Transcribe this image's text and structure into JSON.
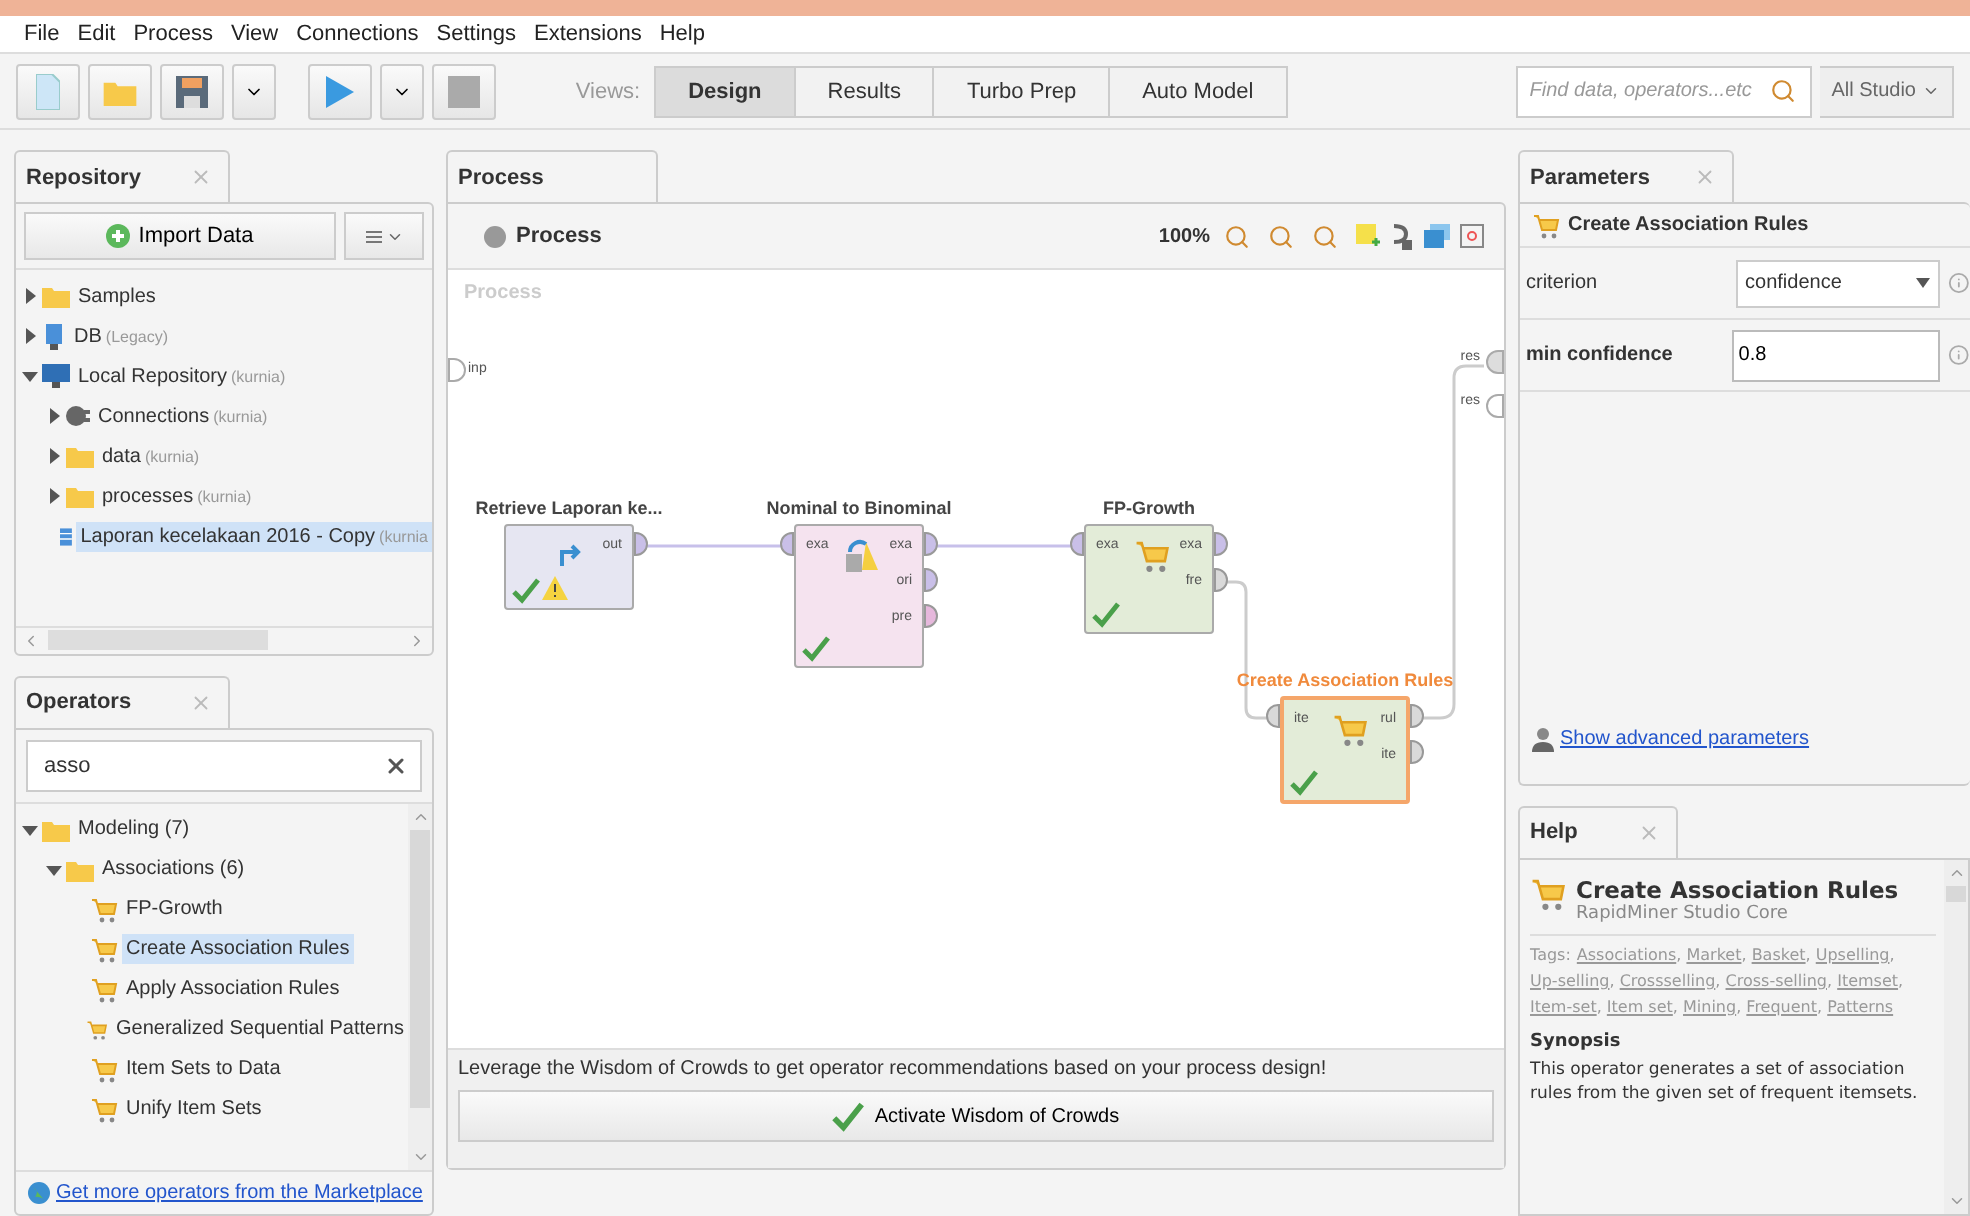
{
  "menu": [
    "File",
    "Edit",
    "Process",
    "View",
    "Connections",
    "Settings",
    "Extensions",
    "Help"
  ],
  "toolbar": {
    "views_label": "Views:",
    "views": [
      {
        "label": "Design",
        "selected": true
      },
      {
        "label": "Results",
        "selected": false
      },
      {
        "label": "Turbo Prep",
        "selected": false
      },
      {
        "label": "Auto Model",
        "selected": false
      }
    ],
    "search": {
      "placeholder": "Find data, operators...etc"
    },
    "scope": "All Studio"
  },
  "repository": {
    "title": "Repository",
    "import_button": "Import Data",
    "items": [
      {
        "name": "Samples",
        "kind": "folder",
        "expanded": false,
        "selected": false
      },
      {
        "name": "DB",
        "note": "(Legacy)",
        "kind": "database",
        "expanded": false,
        "selected": false
      },
      {
        "name": "Local Repository",
        "note": "(kurnia)",
        "kind": "repository",
        "expanded": true,
        "selected": false,
        "children": [
          {
            "name": "Connections",
            "note": "(kurnia)",
            "kind": "connection",
            "expanded": false,
            "selected": false
          },
          {
            "name": "data",
            "note": "(kurnia)",
            "kind": "folder",
            "expanded": false,
            "selected": false
          },
          {
            "name": "processes",
            "note": "(kurnia)",
            "kind": "folder",
            "expanded": false,
            "selected": false
          },
          {
            "name": "Laporan kecelakaan 2016 - Copy",
            "note": "(kurnia",
            "kind": "table",
            "selected": true
          }
        ]
      }
    ]
  },
  "operators": {
    "title": "Operators",
    "search": {
      "value": "asso"
    },
    "items": [
      {
        "name": "Modeling (7)",
        "kind": "folder",
        "expanded": true,
        "selected": false,
        "children": [
          {
            "name": "Associations (6)",
            "kind": "folder",
            "expanded": true,
            "selected": false,
            "children": [
              {
                "name": "FP-Growth",
                "kind": "operator",
                "selected": false
              },
              {
                "name": "Create Association Rules",
                "kind": "operator",
                "selected": true
              },
              {
                "name": "Apply Association Rules",
                "kind": "operator",
                "selected": false
              },
              {
                "name": "Generalized Sequential Patterns",
                "kind": "operator",
                "selected": false
              },
              {
                "name": "Item Sets to Data",
                "kind": "operator",
                "selected": false
              },
              {
                "name": "Unify Item Sets",
                "kind": "operator",
                "selected": false
              }
            ]
          }
        ]
      }
    ],
    "marketplace_link": "Get more operators from the Marketplace"
  },
  "process": {
    "title": "Process",
    "breadcrumb": "Process",
    "zoom": "100%",
    "canvas_label": "Process",
    "input_port": "inp",
    "output_ports": [
      "res",
      "res"
    ],
    "nodes": [
      {
        "title": "Retrieve Laporan ke...",
        "kind": "retrieve",
        "color": "#e6e6f2",
        "selected": false,
        "warning": true,
        "out_ports": [
          {
            "label": "out",
            "color": "#c9bfe8"
          }
        ]
      },
      {
        "title": "Nominal to Binominal",
        "kind": "convert",
        "color": "#f5e3ef",
        "selected": false,
        "warning": false,
        "in_ports": [
          {
            "label": "exa",
            "color": "#c9bfe8"
          }
        ],
        "out_ports": [
          {
            "label": "exa",
            "color": "#c9bfe8"
          },
          {
            "label": "ori",
            "color": "#c9bfe8"
          },
          {
            "label": "pre",
            "color": "#e6b8dc"
          }
        ]
      },
      {
        "title": "FP-Growth",
        "kind": "cart",
        "color": "#e3ecd8",
        "selected": false,
        "warning": false,
        "in_ports": [
          {
            "label": "exa",
            "color": "#c9bfe8"
          }
        ],
        "out_ports": [
          {
            "label": "exa",
            "color": "#c9bfe8"
          },
          {
            "label": "fre",
            "color": "#d9d9d9"
          }
        ]
      },
      {
        "title": "Create Association Rules",
        "kind": "cart",
        "color": "#e3ecd8",
        "selected": true,
        "warning": false,
        "in_ports": [
          {
            "label": "ite",
            "color": "#d9d9d9"
          }
        ],
        "out_ports": [
          {
            "label": "rul",
            "color": "#d9d9d9"
          },
          {
            "label": "ite",
            "color": "#d9d9d9"
          }
        ]
      }
    ],
    "wisdom_text": "Leverage the Wisdom of Crowds to get operator recommendations based on your process design!",
    "wisdom_button": "Activate Wisdom of Crowds"
  },
  "parameters": {
    "title": "Parameters",
    "operator": "Create Association Rules",
    "params": [
      {
        "label": "criterion",
        "value": "confidence",
        "kind": "select"
      },
      {
        "label": "min confidence",
        "value": "0.8",
        "kind": "input"
      }
    ],
    "advanced_link": "Show advanced parameters"
  },
  "help": {
    "title": "Help",
    "operator": "Create Association Rules",
    "subtitle": "RapidMiner Studio Core",
    "tags_label": "Tags:",
    "tag_separator": ",",
    "tags": [
      "Associations",
      "Market",
      "Basket",
      "Upselling",
      "Up-selling",
      "Crossselling",
      "Cross-selling",
      "Itemset",
      "Item-set",
      "Item set",
      "Mining",
      "Frequent",
      "Patterns"
    ],
    "synopsis_heading": "Synopsis",
    "synopsis": "This operator generates a set of association rules from the given set of frequent itemsets."
  }
}
